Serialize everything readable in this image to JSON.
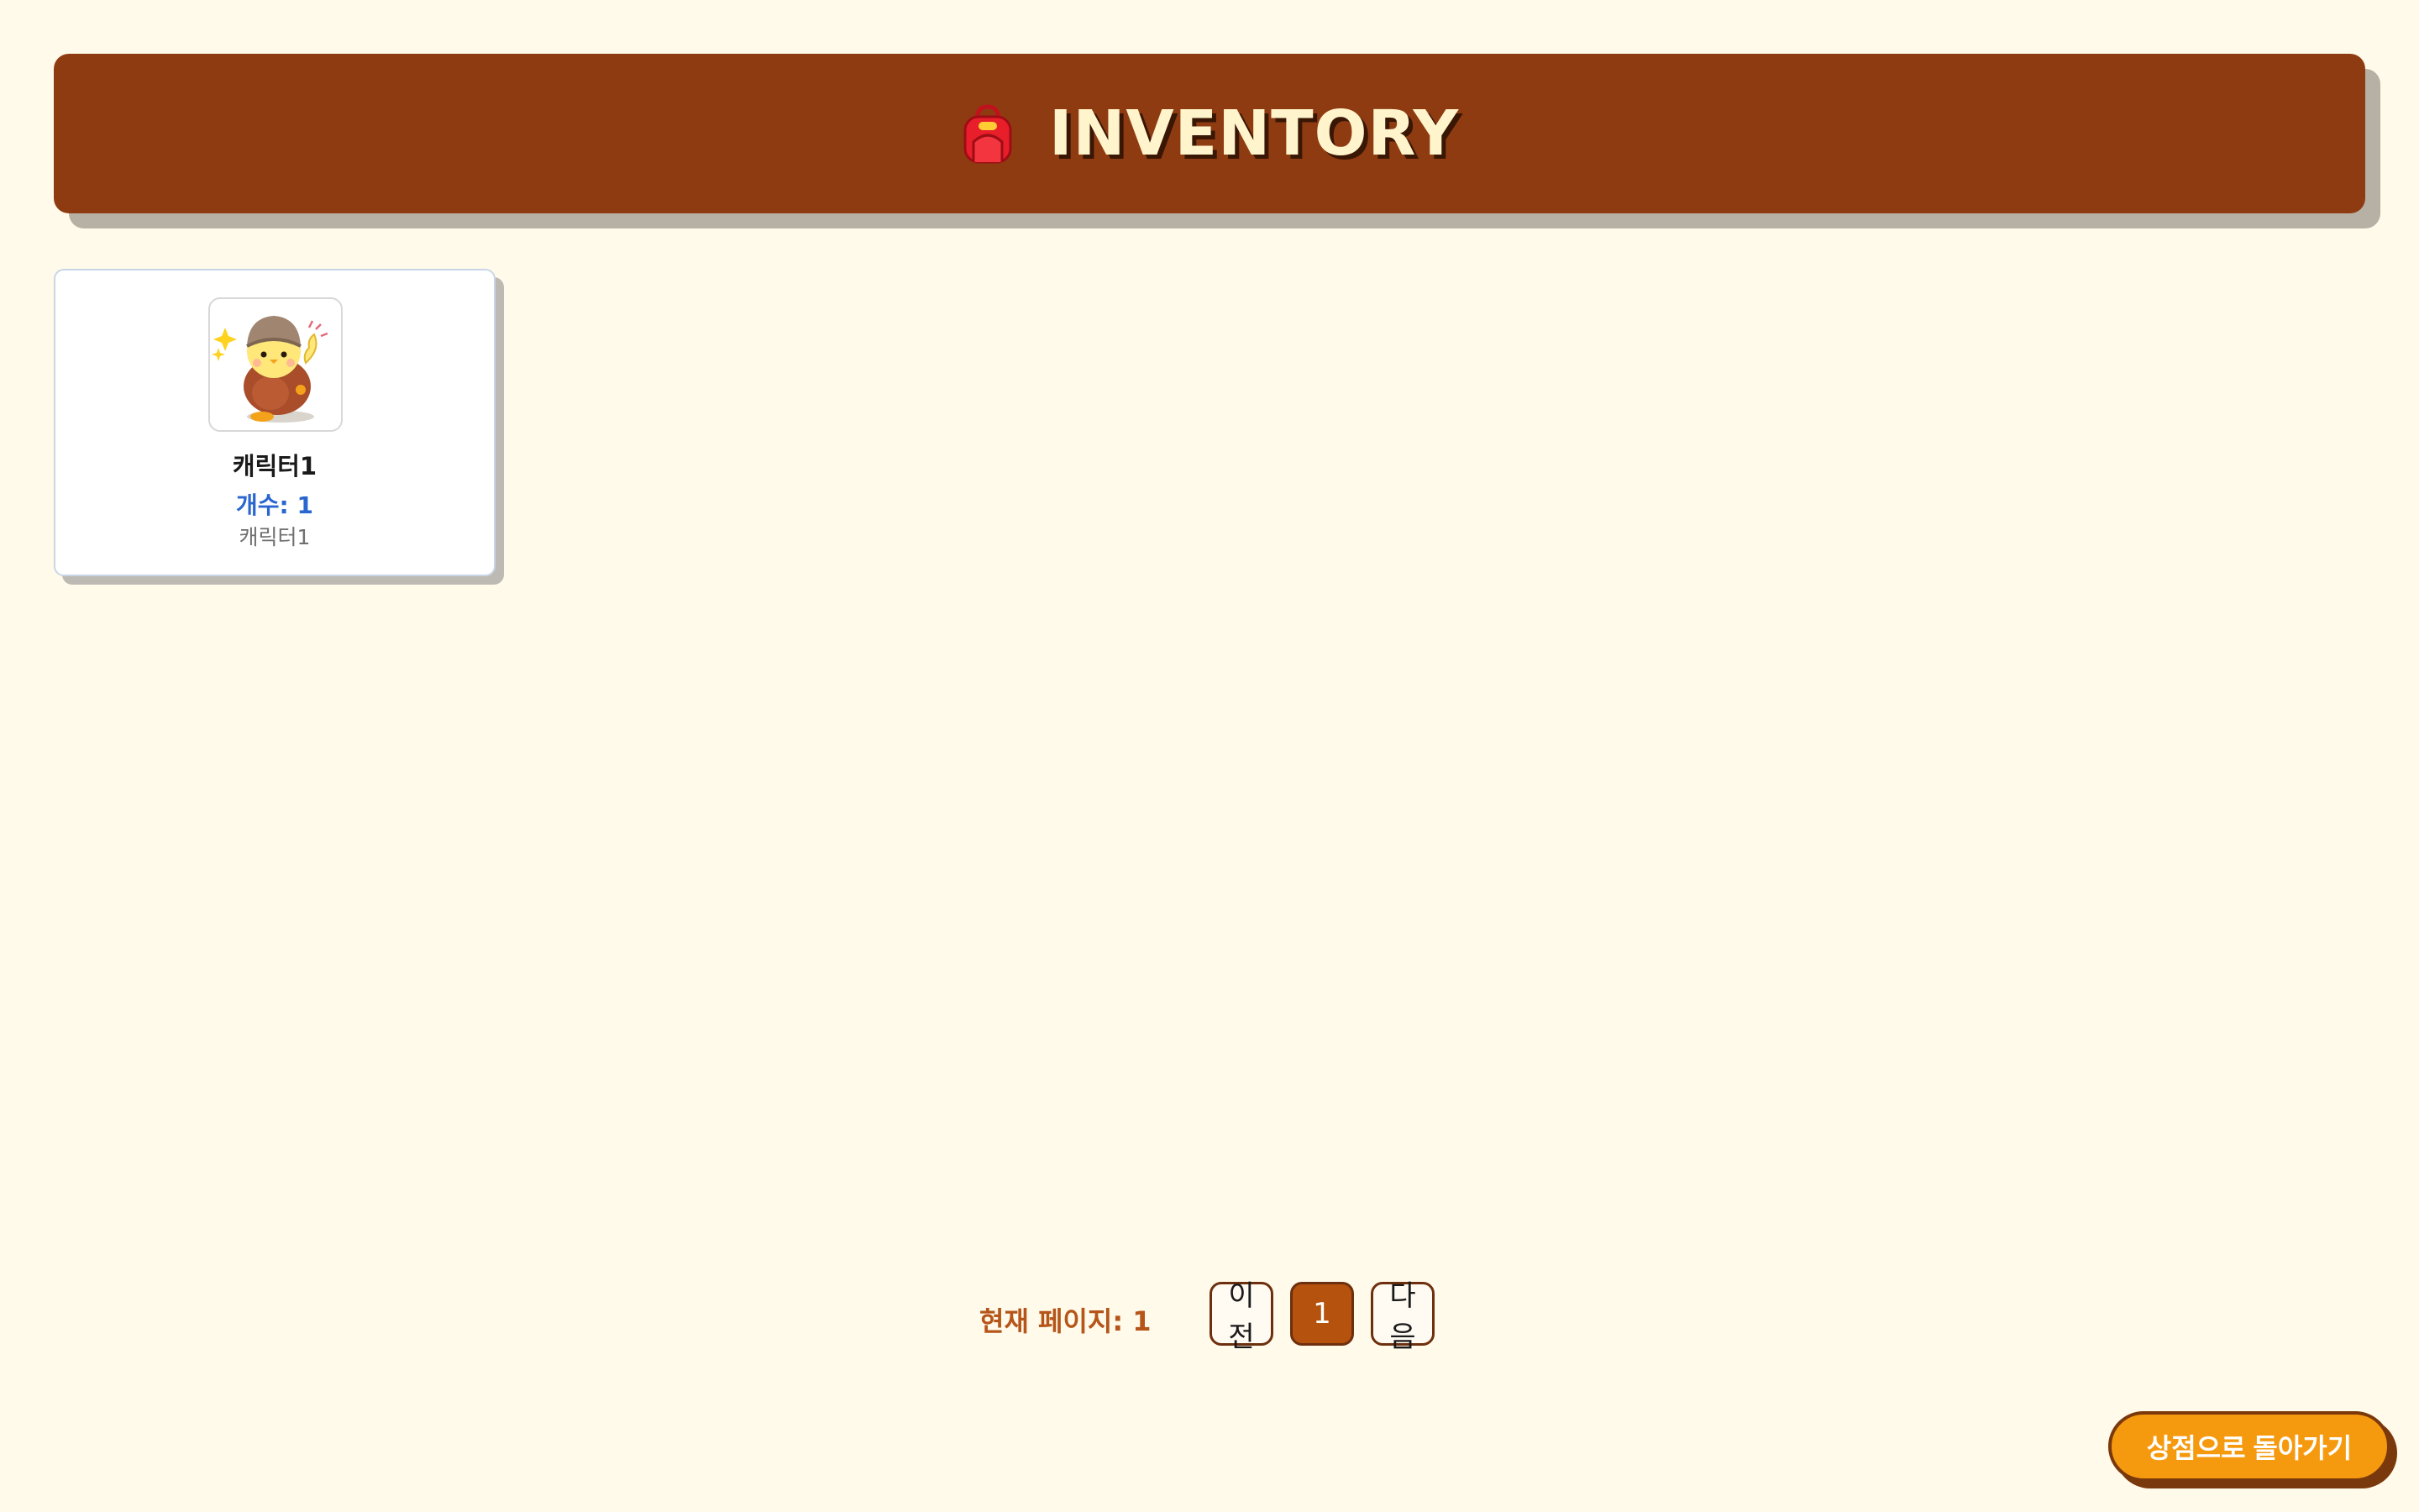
{
  "header": {
    "icon": "backpack-icon",
    "title": "INVENTORY"
  },
  "items": [
    {
      "image": "character-chick-icon",
      "name": "캐릭터1",
      "count_label": "개수: 1",
      "description": "캐릭터1"
    }
  ],
  "pagination": {
    "current_label": "현재 페이지: 1",
    "prev_label": "이전",
    "page_number": "1",
    "next_label": "다음"
  },
  "footer": {
    "back_to_shop_label": "상점으로 돌아가기"
  },
  "colors": {
    "background": "#fffae9",
    "header": "#8f3b11",
    "accent": "#f59a0e",
    "page_active": "#b5520d",
    "count_text": "#2a66cf"
  }
}
